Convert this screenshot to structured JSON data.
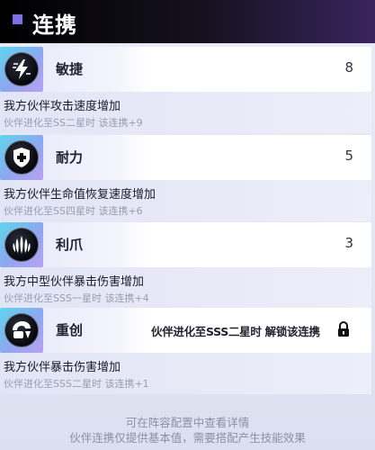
{
  "header": {
    "title": "连携"
  },
  "cards": [
    {
      "icon": "lightning-bolt-icon",
      "name": "敏捷",
      "level": "8",
      "desc": "我方伙伴攻击速度增加",
      "sub": "伙伴进化至SS二星时 该连携+9"
    },
    {
      "icon": "shield-cross-icon",
      "name": "耐力",
      "level": "5",
      "desc": "我方伙伴生命值恢复速度增加",
      "sub": "伙伴进化至SS四星时 该连携+6"
    },
    {
      "icon": "claw-icon",
      "name": "利爪",
      "level": "3",
      "desc": "我方中型伙伴暴击伤害增加",
      "sub": "伙伴进化至SSS一星时 该连携+4"
    },
    {
      "icon": "heavy-blow-icon",
      "name": "重创",
      "locked_text": "伙伴进化至SSS二星时 解锁该连携",
      "lock_icon": "lock-icon",
      "desc": "我方伙伴暴击伤害增加",
      "sub": "伙伴进化至SSS二星时 该连携+1"
    }
  ],
  "footer": {
    "line1": "可在阵容配置中查看详情",
    "line2": "伙伴连携仅提供基本值，需要搭配产生技能效果"
  },
  "colors": {
    "accent": "#7f6fe6",
    "icon_gradient_start": "#5fd6ee",
    "icon_gradient_end": "#b9a2f3",
    "header_bg": "#000000"
  }
}
